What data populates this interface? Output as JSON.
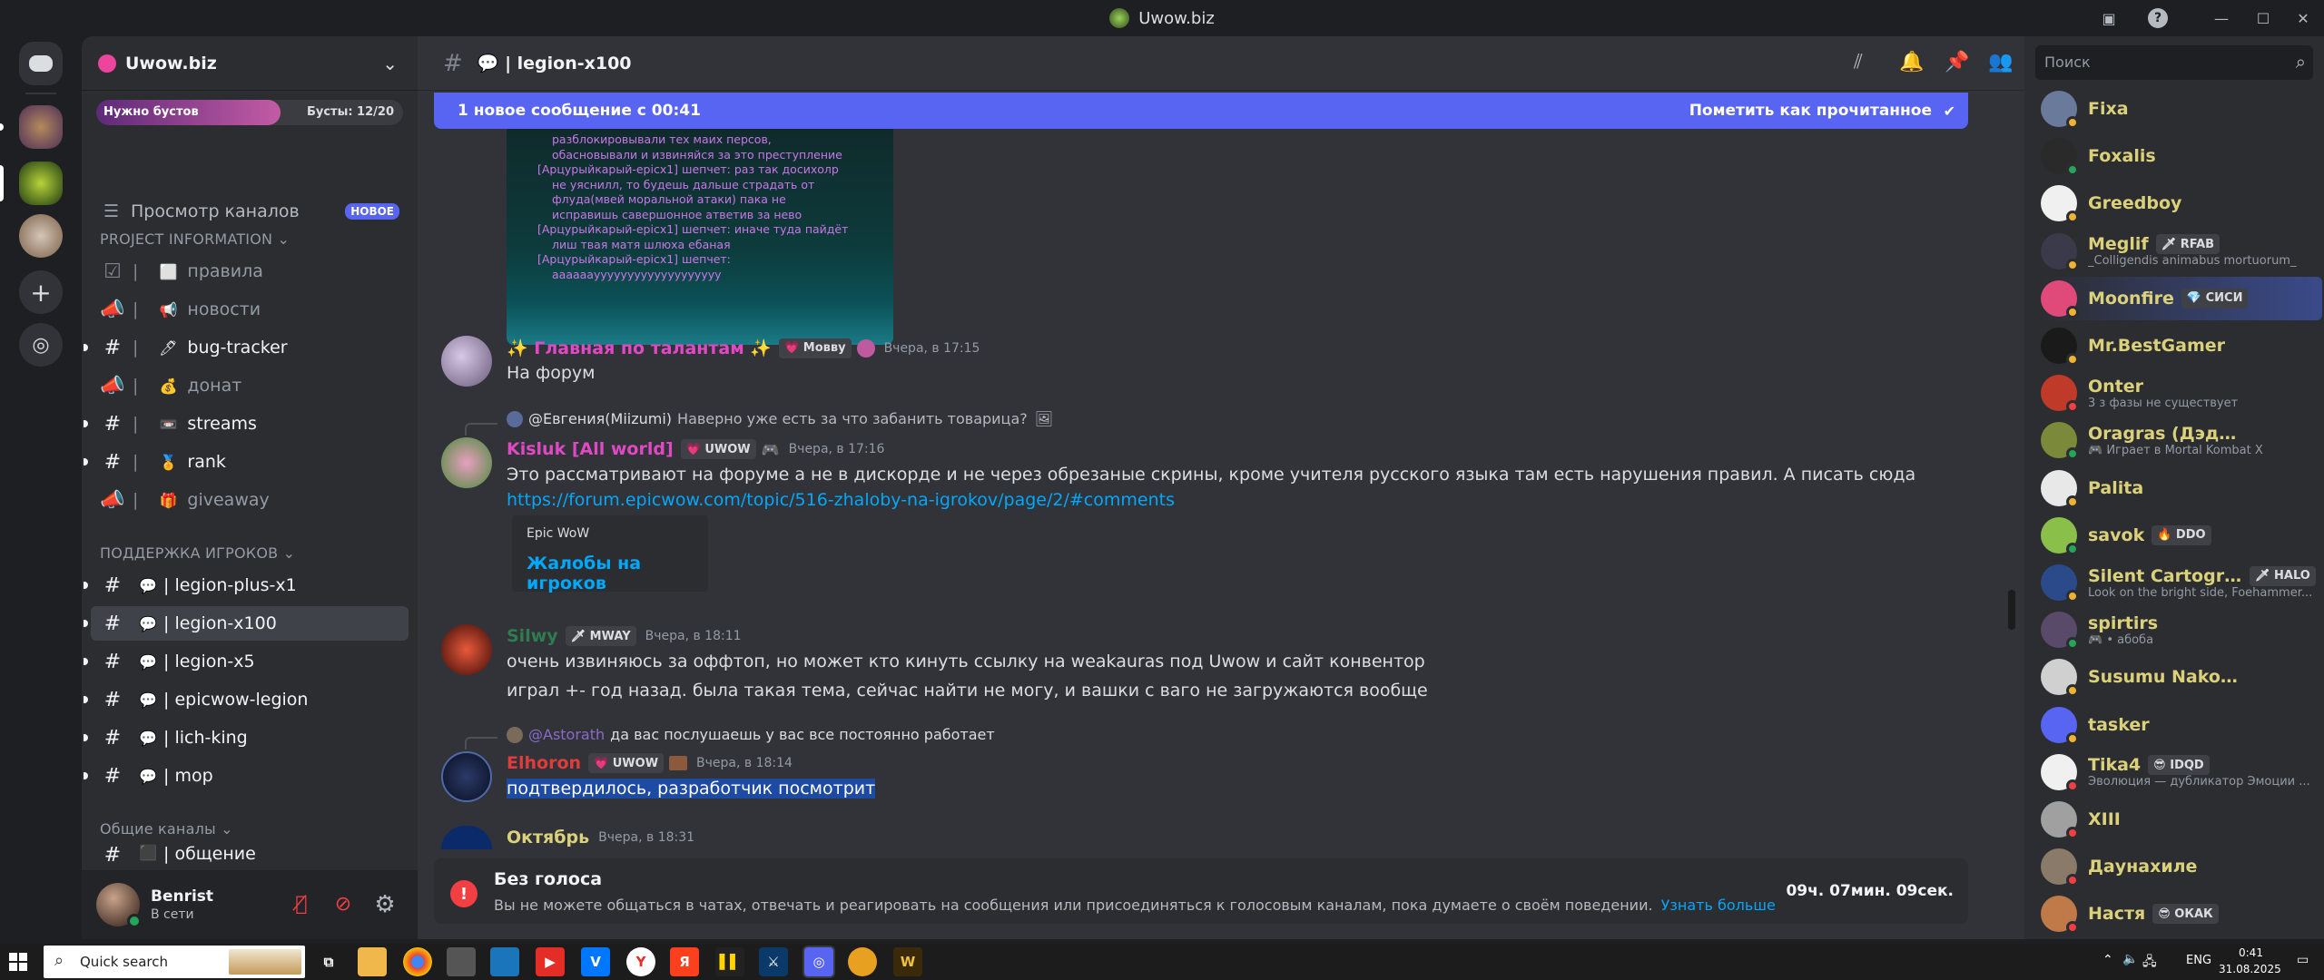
{
  "window": {
    "title": "Uwow.biz"
  },
  "server": {
    "name": "Uwow.biz",
    "boost_left": "Нужно бустов",
    "boost_right": "Бусты: 12/20",
    "boost_progress": 0.6
  },
  "sidebar": {
    "browse": {
      "label": "Просмотр каналов",
      "badge": "НОВОЕ"
    },
    "categories": [
      {
        "label": "PROJECT INFORMATION ⌄"
      },
      {
        "label": "ПОДДЕРЖКА ИГРОКОВ ⌄"
      },
      {
        "label": "Общие каналы ⌄"
      }
    ],
    "channels": [
      {
        "icon": "rules-icon",
        "emoji": "⬜",
        "label": "правила",
        "unread": false
      },
      {
        "icon": "announce-icon",
        "emoji": "📢",
        "label": "новости",
        "unread": false
      },
      {
        "icon": "hash-icon",
        "emoji": "🖊",
        "label": "bug-tracker",
        "unread": true
      },
      {
        "icon": "announce-icon",
        "emoji": "💰",
        "label": "донат",
        "unread": false
      },
      {
        "icon": "hash-icon",
        "emoji": "📼",
        "label": "streams",
        "unread": true
      },
      {
        "icon": "hash-icon",
        "emoji": "🏅",
        "label": "rank",
        "unread": true
      },
      {
        "icon": "announce-icon",
        "emoji": "🎁",
        "label": "giveaway",
        "unread": false
      },
      {
        "icon": "hash-icon",
        "emoji": "💬",
        "label": "| legion-plus-x1",
        "unread": true
      },
      {
        "icon": "hash-icon",
        "emoji": "💬",
        "label": "| legion-x100",
        "unread": true
      },
      {
        "icon": "hash-icon",
        "emoji": "💬",
        "label": "| legion-x5",
        "unread": true
      },
      {
        "icon": "hash-icon",
        "emoji": "💬",
        "label": "| epicwow-legion",
        "unread": true
      },
      {
        "icon": "hash-icon",
        "emoji": "💬",
        "label": "| lich-king",
        "unread": true
      },
      {
        "icon": "hash-icon",
        "emoji": "💬",
        "label": "| mop",
        "unread": true
      },
      {
        "icon": "hash-icon",
        "emoji": "⬛",
        "label": "| общение",
        "unread": false
      }
    ]
  },
  "user": {
    "name": "Benrist",
    "status": "В сети"
  },
  "channel": {
    "name": "💬 | legion-x100",
    "new_messages": "1 новое сообщение с 00:41",
    "mark_read": "Пометить как прочитанное"
  },
  "embed_image": {
    "lines": [
      "разблокировывали тех маих персов,",
      "обасновывали и извиняйся за это преступление",
      "[Арцурыйкарый-epicx1] шепчет: раз так досихолр",
      "не уяснилл, то будешь дальше страдать от",
      "флуда(мвей моральной атаки) пака не",
      "исправишь савершонное атветив за нево",
      "[Арцурыйкарый-epicx1] шепчет: иначе туда пайдёт",
      "лиш твая матя шлюха ебаная",
      "[Арцурыйкарый-epicx1] шепчет:",
      "ааааааууууууууууууууууууу"
    ]
  },
  "messages": [
    {
      "author": "✨ Главная по талантам ✨",
      "tag": "💗 Mовву",
      "time": "Вчера, в 17:15",
      "text": "На форум"
    },
    {
      "reply_to": "@Евгения(Miizumi)",
      "reply_text": "Наверно уже есть за что забанить товарица?",
      "author": "Kisluk [All world]",
      "tag": "💗 UWOW",
      "time": "Вчера, в 17:16",
      "text": "Это рассматривают на форуме а не в дискорде и не через обрезаные скрины, кроме учителя русского языка там есть нарушения правил. А писать сюда",
      "link": "https://forum.epicwow.com/topic/516-zhaloby-na-igrokov/page/2/#comments",
      "embed_site": "Epic WoW",
      "embed_title": "Жалобы на игроков"
    },
    {
      "author": "Silwy",
      "tag": "🗡 MWAY",
      "time": "Вчера, в 18:11",
      "text": "очень извиняюсь за оффтоп, но может кто кинуть ссылку на weakauras под Uwow и сайт конвентор",
      "text2": "играл +- год назад. была такая тема, сейчас найти не могу, и вашки с ваго не загружаются вообще"
    },
    {
      "reply_to": "@Astorath",
      "reply_text": "да вас послушаешь у вас все постоянно работает",
      "author": "Elhoron",
      "tag": "💗 UWOW",
      "time": "Вчера, в 18:14",
      "text": "подтвердилось, разработчик посмотрит"
    },
    {
      "author": "Октябрь",
      "time": "Вчера, в 18:31"
    }
  ],
  "timeout": {
    "title": "Без голоса",
    "text": "Вы не можете общаться в чатах, отвечать и реагировать на сообщения или присоединяться к голосовым каналам, пока думаете о своём поведении.",
    "link": "Узнать больше",
    "remaining": "09ч. 07мин. 09сек."
  },
  "search": {
    "placeholder": "Поиск"
  },
  "members": [
    {
      "name": "Fixa",
      "color": "#dcd17b",
      "status": "",
      "tag": "",
      "st": "#f0b232"
    },
    {
      "name": "Foxalis",
      "color": "#dcd17b",
      "status": "",
      "tag": "",
      "st": "#23a55a"
    },
    {
      "name": "Greedboy",
      "color": "#dcd17b",
      "status": "",
      "tag": "",
      "st": "#f0b232"
    },
    {
      "name": "Meglif",
      "color": "#dcd17b",
      "status": "_Colligendis animabus mortuorum_",
      "tag": "🗡 RFAB",
      "st": "#f0b232"
    },
    {
      "name": "Moonfire",
      "color": "#dcd17b",
      "status": "",
      "tag": "💎 СИСИ",
      "st": "#f0b232"
    },
    {
      "name": "Mr.BestGamer",
      "color": "#dcd17b",
      "status": "",
      "tag": "",
      "st": "#f0b232"
    },
    {
      "name": "Onter",
      "color": "#dcd17b",
      "status": "3 з фазы не существует",
      "tag": "",
      "st": "#f23f43"
    },
    {
      "name": "Oragras (Дэдрис)",
      "color": "#dcd17b",
      "status": "🎮 Играет в Mortal Kombat X",
      "tag": "",
      "st": "#23a55a"
    },
    {
      "name": "Palita",
      "color": "#dcd17b",
      "status": "",
      "tag": "",
      "st": "#f0b232"
    },
    {
      "name": "savok",
      "color": "#dcd17b",
      "status": "",
      "tag": "🔥 DDO",
      "st": "#23a55a"
    },
    {
      "name": "Silent Cartograp...",
      "color": "#dcd17b",
      "status": "Look on the bright side, Foehammer...",
      "tag": "🗡 HALO",
      "st": "#f0b232"
    },
    {
      "name": "spirtirs",
      "color": "#dcd17b",
      "status": "🎮 • абоба",
      "tag": "",
      "st": "#23a55a"
    },
    {
      "name": "Susumu Nakoshi",
      "color": "#dcd17b",
      "status": "",
      "tag": "",
      "st": "#f0b232"
    },
    {
      "name": "tasker",
      "color": "#dcd17b",
      "status": "",
      "tag": "",
      "st": "#f0b232"
    },
    {
      "name": "Tika4",
      "color": "#dcd17b",
      "status": "Эволюция — дубликатор Эмоции ...",
      "tag": "😎 IDQD",
      "st": "#f23f43"
    },
    {
      "name": "XIII",
      "color": "#dcd17b",
      "status": "",
      "tag": "",
      "st": "#f23f43"
    },
    {
      "name": "Даунахиле",
      "color": "#dcd17b",
      "status": "",
      "tag": "",
      "st": "#f23f43"
    },
    {
      "name": "Настя",
      "color": "#dcd17b",
      "status": "",
      "tag": "😎 ОКАК",
      "st": "#f23f43"
    }
  ],
  "taskbar": {
    "search": "Quick search",
    "lang": "ENG",
    "time": "0:41",
    "date": "31.08.2025"
  },
  "colors": {
    "accent": "#5865f2",
    "link": "#00a8fc",
    "danger": "#f23f43",
    "online": "#23a55a",
    "idle": "#f0b232"
  }
}
